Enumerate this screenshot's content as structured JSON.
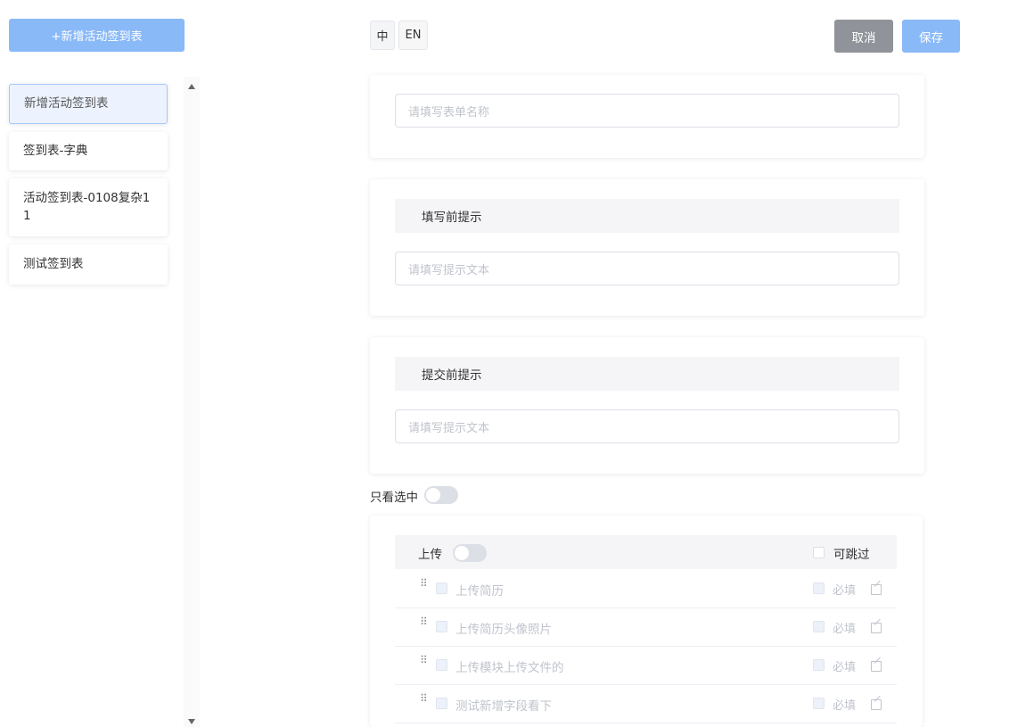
{
  "sidebar": {
    "add_button": "+新增活动签到表",
    "items": [
      {
        "label": "新增活动签到表"
      },
      {
        "label": "签到表-字典"
      },
      {
        "label": "活动签到表-0108复杂11"
      },
      {
        "label": "测试签到表"
      }
    ]
  },
  "header": {
    "lang_zh": "中",
    "lang_en": "EN",
    "cancel": "取消",
    "save": "保存"
  },
  "form": {
    "name_placeholder": "请填写表单名称",
    "before_fill": {
      "title": "填写前提示",
      "placeholder": "请填写提示文本"
    },
    "before_submit": {
      "title": "提交前提示",
      "placeholder": "请填写提示文本"
    },
    "only_selected_label": "只看选中"
  },
  "upload": {
    "title": "上传",
    "skippable": "可跳过",
    "rows": [
      {
        "name": "上传简历",
        "required": "必填"
      },
      {
        "name": "上传简历头像照片",
        "required": "必填"
      },
      {
        "name": "上传模块上传文件的",
        "required": "必填"
      },
      {
        "name": "测试新增字段看下",
        "required": "必填"
      }
    ]
  }
}
